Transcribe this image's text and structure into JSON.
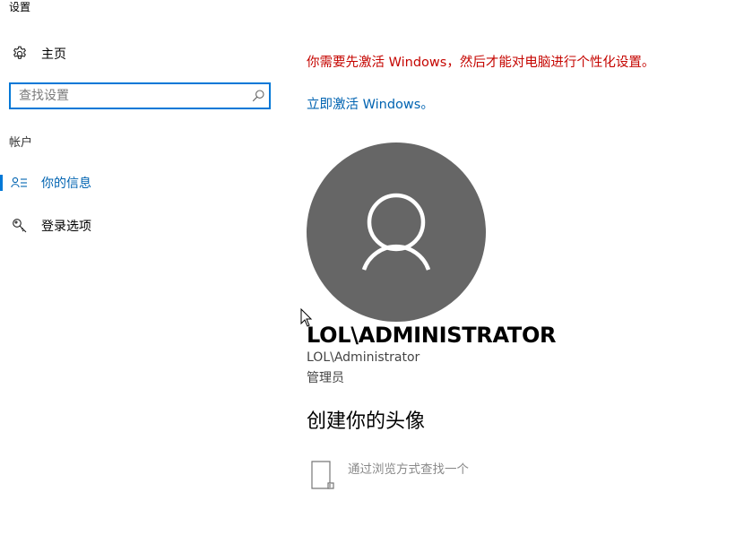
{
  "app": {
    "title": "设置"
  },
  "sidebar": {
    "home_label": "主页",
    "search": {
      "placeholder": "查找设置",
      "value": ""
    },
    "section_header": "帐户",
    "items": [
      {
        "label": "你的信息",
        "icon": "person-list-icon",
        "selected": true
      },
      {
        "label": "登录选项",
        "icon": "key-icon",
        "selected": false
      }
    ]
  },
  "main": {
    "activation_warning": "你需要先激活 Windows，然后才能对电脑进行个性化设置。",
    "activate_link": "立即激活 Windows。",
    "avatar_icon": "user-silhouette-icon",
    "display_name": "LOL\\ADMINISTRATOR",
    "account_id": "LOL\\Administrator",
    "account_role": "管理员",
    "create_heading": "创建你的头像",
    "browse_label": "通过浏览方式查找一个",
    "browse_icon": "file-icon"
  },
  "colors": {
    "accent": "#0078d7",
    "link": "#0063b1",
    "warning": "#c50500",
    "avatar_bg": "#666666"
  }
}
